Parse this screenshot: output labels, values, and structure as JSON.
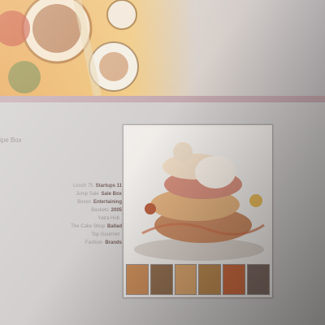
{
  "sidebar": {
    "title": "ipe Box",
    "details": [
      {
        "key": "Lunch 75",
        "value": "Startups 11"
      },
      {
        "key": "Jump Sale",
        "value": "Sale Box"
      },
      {
        "key": "Boxes",
        "value": "Entertaining"
      },
      {
        "key": "Baskets",
        "value": "2005"
      },
      {
        "key": "Yatra Hub",
        "value": ""
      },
      {
        "key": "The Cake Shop",
        "value": "Ballad"
      },
      {
        "key": "Top Gourmet",
        "value": ""
      },
      {
        "key": "Fashion",
        "value": "Brands"
      }
    ]
  },
  "gallery": {
    "thumbnail_count": 6
  },
  "caption": {
    "line1": "",
    "line2": ""
  }
}
